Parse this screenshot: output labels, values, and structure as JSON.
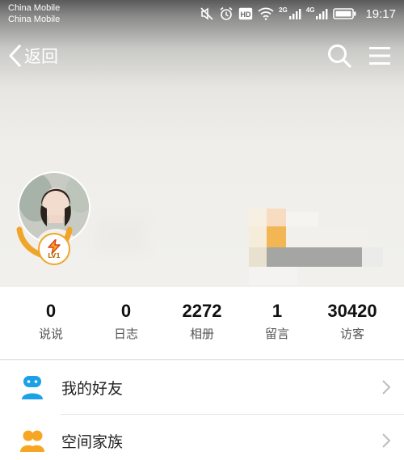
{
  "status_bar": {
    "carrier_1": "China Mobile",
    "carrier_2": "China Mobile",
    "signal_1_label": "2G",
    "signal_2_label": "4G",
    "hd_label": "HD",
    "time": "19:17",
    "icons": [
      "mute-icon",
      "alarm-icon",
      "hd-icon",
      "wifi-icon",
      "signal-icon",
      "signal-icon",
      "battery-icon"
    ]
  },
  "nav": {
    "back_label": "返回",
    "icons": [
      "back-chevron-icon",
      "search-icon",
      "menu-icon"
    ]
  },
  "profile": {
    "level_badge": "LV1",
    "avatar_alt": "avatar",
    "badge_color": "#f0a52a"
  },
  "stats": [
    {
      "value": "0",
      "label": "说说"
    },
    {
      "value": "0",
      "label": "日志"
    },
    {
      "value": "2272",
      "label": "相册"
    },
    {
      "value": "1",
      "label": "留言"
    },
    {
      "value": "30420",
      "label": "访客"
    }
  ],
  "menu": [
    {
      "label": "我的好友",
      "icon": "friends-icon",
      "color": "#1aa1e8"
    },
    {
      "label": "空间家族",
      "icon": "family-icon",
      "color": "#f6a623"
    }
  ]
}
